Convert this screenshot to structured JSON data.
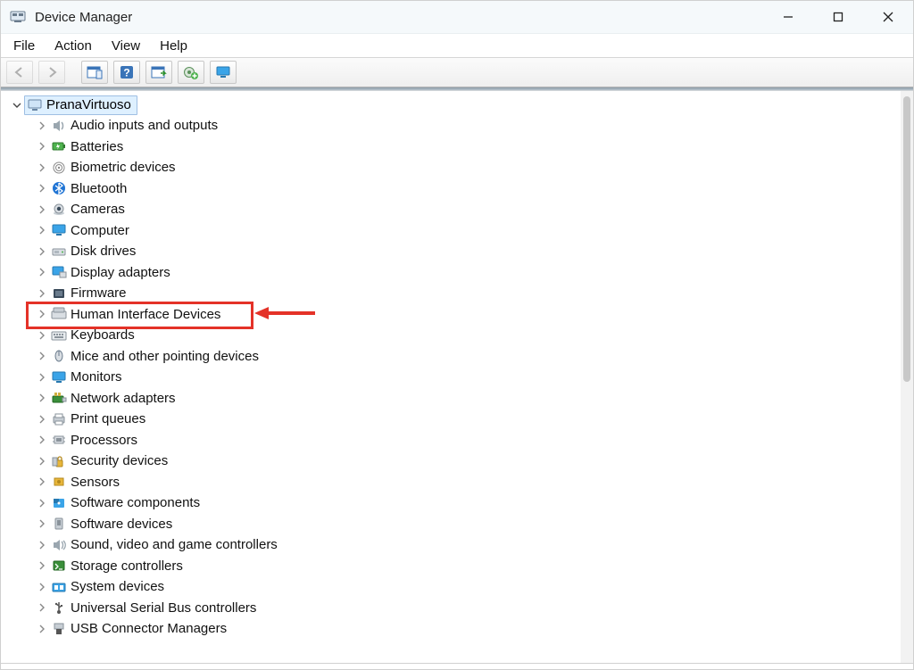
{
  "window": {
    "title": "Device Manager"
  },
  "menu": {
    "file": "File",
    "action": "Action",
    "view": "View",
    "help": "Help"
  },
  "tree": {
    "root": "PranaVirtuoso",
    "items": [
      {
        "label": "Audio inputs and outputs",
        "icon": "speaker-icon"
      },
      {
        "label": "Batteries",
        "icon": "battery-icon"
      },
      {
        "label": "Biometric devices",
        "icon": "fingerprint-icon"
      },
      {
        "label": "Bluetooth",
        "icon": "bluetooth-icon"
      },
      {
        "label": "Cameras",
        "icon": "camera-icon"
      },
      {
        "label": "Computer",
        "icon": "monitor-icon"
      },
      {
        "label": "Disk drives",
        "icon": "disk-icon"
      },
      {
        "label": "Display adapters",
        "icon": "display-adapter-icon"
      },
      {
        "label": "Firmware",
        "icon": "firmware-icon"
      },
      {
        "label": "Human Interface Devices",
        "icon": "hid-icon",
        "highlighted": true
      },
      {
        "label": "Keyboards",
        "icon": "keyboard-icon"
      },
      {
        "label": "Mice and other pointing devices",
        "icon": "mouse-icon"
      },
      {
        "label": "Monitors",
        "icon": "monitor-icon"
      },
      {
        "label": "Network adapters",
        "icon": "network-icon"
      },
      {
        "label": "Print queues",
        "icon": "printer-icon"
      },
      {
        "label": "Processors",
        "icon": "cpu-icon"
      },
      {
        "label": "Security devices",
        "icon": "security-icon"
      },
      {
        "label": "Sensors",
        "icon": "sensor-icon"
      },
      {
        "label": "Software components",
        "icon": "puzzle-icon"
      },
      {
        "label": "Software devices",
        "icon": "software-device-icon"
      },
      {
        "label": "Sound, video and game controllers",
        "icon": "sound-icon"
      },
      {
        "label": "Storage controllers",
        "icon": "storage-icon"
      },
      {
        "label": "System devices",
        "icon": "system-icon"
      },
      {
        "label": "Universal Serial Bus controllers",
        "icon": "usb-icon"
      },
      {
        "label": "USB Connector Managers",
        "icon": "usb-connector-icon"
      }
    ]
  }
}
